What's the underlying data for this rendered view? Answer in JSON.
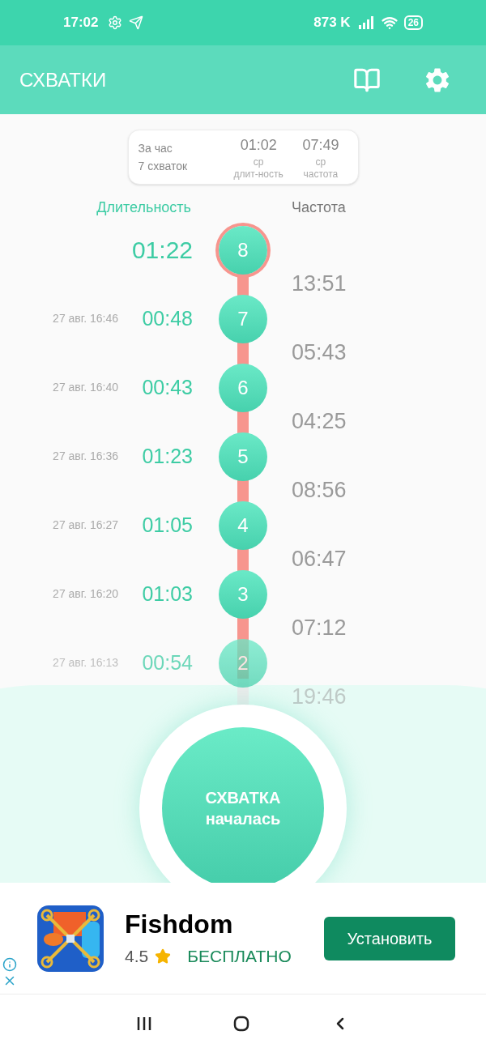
{
  "status_bar": {
    "time": "17:02",
    "speed": "873 K",
    "battery": "26"
  },
  "app_bar": {
    "title": "СХВАТКИ"
  },
  "summary": {
    "period": "За час",
    "count": "7 схваток",
    "avg_duration": "01:02",
    "avg_duration_label": "ср\nдлит-ность",
    "avg_frequency": "07:49",
    "avg_frequency_label": "ср\nчастота"
  },
  "columns": [
    {
      "label": "Длительность",
      "selected": true
    },
    {
      "label": "Частота",
      "selected": false
    }
  ],
  "contractions": [
    {
      "number": "8",
      "duration": "01:22",
      "current": true,
      "dimmed": false
    },
    {
      "number": "7",
      "date": "27 авг. 16:46",
      "duration": "00:48",
      "current": false,
      "dimmed": false
    },
    {
      "number": "6",
      "date": "27 авг. 16:40",
      "duration": "00:43",
      "current": false,
      "dimmed": false
    },
    {
      "number": "5",
      "date": "27 авг. 16:36",
      "duration": "01:23",
      "current": false,
      "dimmed": false
    },
    {
      "number": "4",
      "date": "27 авг. 16:27",
      "duration": "01:05",
      "current": false,
      "dimmed": false
    },
    {
      "number": "3",
      "date": "27 авг. 16:20",
      "duration": "01:03",
      "current": false,
      "dimmed": false
    },
    {
      "number": "2",
      "date": "27 авг. 16:13",
      "duration": "00:54",
      "current": false,
      "dimmed": true
    }
  ],
  "intervals": [
    {
      "value": "13:51",
      "dimmed": false
    },
    {
      "value": "05:43",
      "dimmed": false
    },
    {
      "value": "04:25",
      "dimmed": false
    },
    {
      "value": "08:56",
      "dimmed": false
    },
    {
      "value": "06:47",
      "dimmed": false
    },
    {
      "value": "07:12",
      "dimmed": false
    },
    {
      "value": "19:46",
      "dimmed": true
    }
  ],
  "start_button": {
    "line1": "СХВАТКА",
    "line2": "началась"
  },
  "ad": {
    "title": "Fishdom",
    "rating": "4.5",
    "price": "БЕСПЛАТНО",
    "button": "Установить"
  }
}
